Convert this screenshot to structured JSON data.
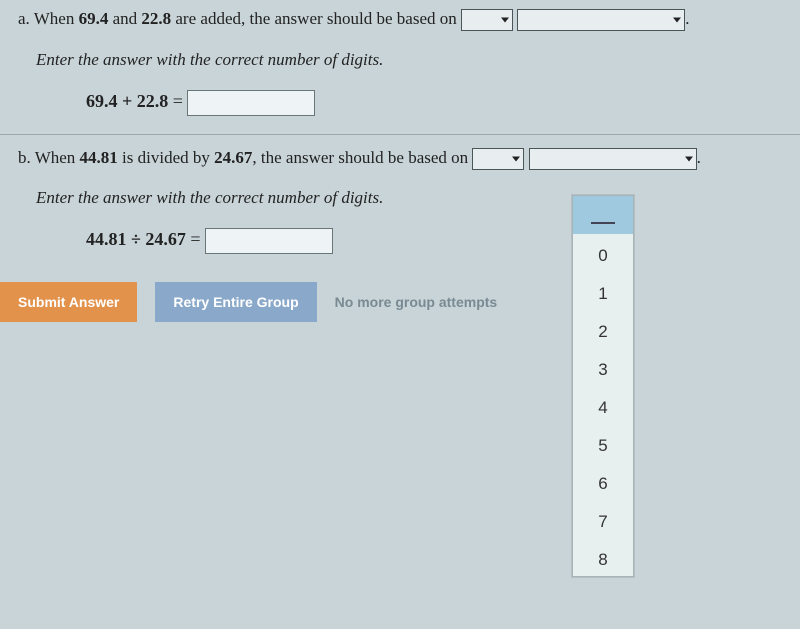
{
  "a": {
    "letter": "a.",
    "when": "When ",
    "v1": "69.4",
    "and": " and ",
    "v2": "22.8",
    "rest": " are added, the answer should be based on ",
    "period": ".",
    "instruction": "Enter the answer with the correct number of digits.",
    "eq_lhs": "69.4 + 22.8",
    "equals": "="
  },
  "b": {
    "letter": "b.",
    "when": "When ",
    "v1": "44.81",
    "mid": " is divided by ",
    "v2": "24.67",
    "rest": ", the answer should be based on ",
    "period": ".",
    "instruction": "Enter the answer with the correct number of digits.",
    "eq_lhs": "44.81 ÷ 24.67",
    "equals": "="
  },
  "buttons": {
    "submit": "Submit Answer",
    "retry": "Retry Entire Group",
    "no_more": "No more group attempts"
  },
  "dropdown_options": [
    "",
    "0",
    "1",
    "2",
    "3",
    "4",
    "5",
    "6",
    "7",
    "8"
  ]
}
